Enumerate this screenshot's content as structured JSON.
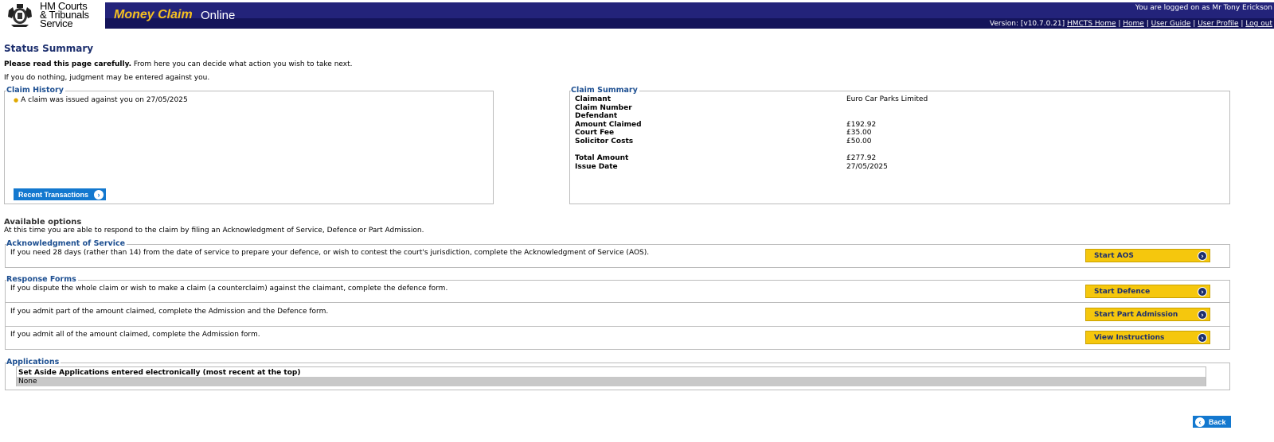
{
  "header": {
    "logo_lines": [
      "HM Courts",
      "& Tribunals",
      "Service"
    ],
    "brand": "Money Claim",
    "brand_suffix": "Online",
    "logged_on": "You are logged on as Mr Tony Erickson",
    "version": "Version: [v10.7.0.21]",
    "links": [
      "HMCTS Home",
      "Home",
      "User Guide",
      "User Profile",
      "Log out"
    ],
    "banner_color": "#1d1d6f",
    "brand_color": "#f5c020"
  },
  "page": {
    "title": "Status Summary",
    "intro_bold": "Please read this page carefully.",
    "intro_rest": " From here you can decide what action you wish to take next.",
    "intro2": "If you do nothing, judgment may be entered against you."
  },
  "claim_history": {
    "legend": "Claim History",
    "items": [
      "A claim was issued against you on 27/05/2025"
    ],
    "button": "Recent Transactions"
  },
  "claim_summary": {
    "legend": "Claim Summary",
    "rows": [
      {
        "label": "Claimant",
        "value": "Euro Car Parks Limited"
      },
      {
        "label": "Claim Number",
        "value": ""
      },
      {
        "label": "Defendant",
        "value": ""
      },
      {
        "label": "Amount Claimed",
        "value": "£192.92"
      },
      {
        "label": "Court Fee",
        "value": "£35.00"
      },
      {
        "label": "Solicitor Costs",
        "value": "£50.00"
      },
      {
        "label": "Total Amount",
        "value": "£277.92"
      },
      {
        "label": "Issue Date",
        "value": "27/05/2025"
      }
    ]
  },
  "available": {
    "title": "Available options",
    "text": "At this time you are able to respond to the claim by filing an Acknowledgment of Service, Defence or Part Admission."
  },
  "aos": {
    "legend": "Acknowledgment of Service",
    "text": "If you need 28 days (rather than 14) from the date of service to prepare your defence, or wish to contest the court's jurisdiction, complete the Acknowledgment of Service (AOS).",
    "button": "Start AOS"
  },
  "response": {
    "legend": "Response Forms",
    "rows": [
      {
        "text": "If you dispute the whole claim or wish to make a claim (a counterclaim) against the claimant, complete the defence form.",
        "button": "Start Defence"
      },
      {
        "text": "If you admit part of the amount claimed, complete the Admission and the Defence form.",
        "button": "Start Part Admission"
      },
      {
        "text": "If you admit all of the amount claimed, complete the Admission form.",
        "button": "View Instructions"
      }
    ]
  },
  "applications": {
    "legend": "Applications",
    "header": "Set Aside Applications entered electronically (most recent at the top)",
    "empty": "None"
  },
  "back_button": "Back"
}
